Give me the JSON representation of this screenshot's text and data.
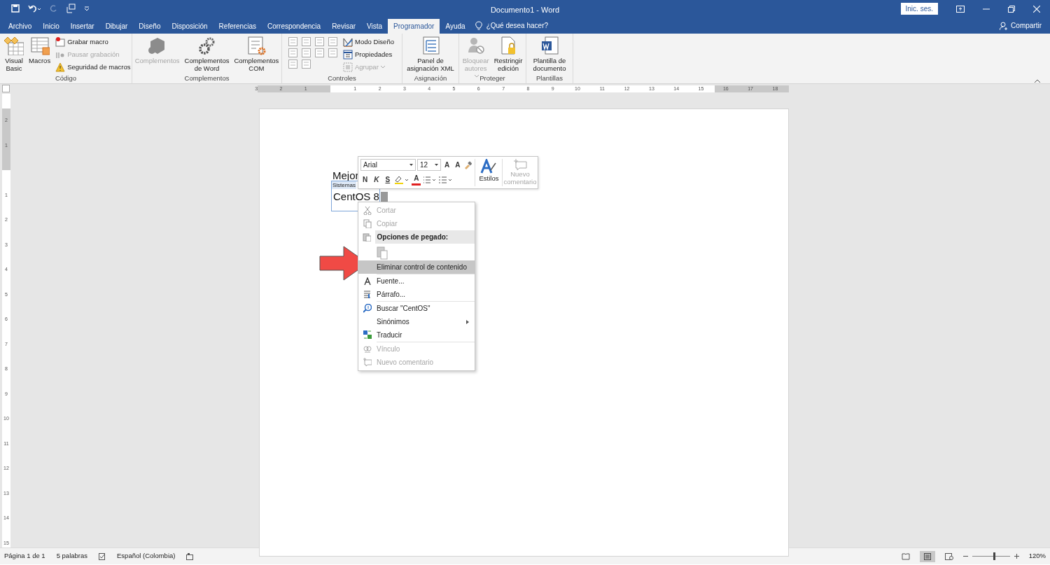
{
  "window": {
    "title": "Documento1  -  Word",
    "sign_in": "Inic. ses."
  },
  "tabs": [
    {
      "label": "Archivo",
      "selected": false
    },
    {
      "label": "Inicio",
      "selected": false
    },
    {
      "label": "Insertar",
      "selected": false
    },
    {
      "label": "Dibujar",
      "selected": false
    },
    {
      "label": "Diseño",
      "selected": false
    },
    {
      "label": "Disposición",
      "selected": false
    },
    {
      "label": "Referencias",
      "selected": false
    },
    {
      "label": "Correspondencia",
      "selected": false
    },
    {
      "label": "Revisar",
      "selected": false
    },
    {
      "label": "Vista",
      "selected": false
    },
    {
      "label": "Programador",
      "selected": true
    },
    {
      "label": "Ayuda",
      "selected": false
    }
  ],
  "tell_me": "¿Qué desea hacer?",
  "share": "Compartir",
  "ribbon": [
    {
      "name": "Código",
      "items": [
        {
          "kind": "large",
          "label": "Visual Basic",
          "disabled": false
        },
        {
          "kind": "large",
          "label": "Macros",
          "disabled": false
        },
        {
          "kind": "stack",
          "entries": [
            {
              "label": "Grabar macro",
              "disabled": false
            },
            {
              "label": "Pausar grabación",
              "disabled": true
            },
            {
              "label": "Seguridad de macros",
              "disabled": false
            }
          ]
        }
      ]
    },
    {
      "name": "Complementos",
      "items": [
        {
          "kind": "large",
          "label": "Complementos",
          "disabled": true
        },
        {
          "kind": "large",
          "label": "Complementos de Word",
          "disabled": false
        },
        {
          "kind": "large",
          "label": "Complementos COM",
          "disabled": false
        }
      ]
    },
    {
      "name": "Controles",
      "items": [
        {
          "kind": "grid"
        },
        {
          "kind": "stack",
          "entries": [
            {
              "label": "Modo Diseño",
              "disabled": false
            },
            {
              "label": "Propiedades",
              "disabled": false
            },
            {
              "label": "Agrupar",
              "disabled": true,
              "dropdown": true
            }
          ]
        }
      ]
    },
    {
      "name": "Asignación",
      "items": [
        {
          "kind": "large",
          "label": "Panel de asignación XML",
          "disabled": false
        }
      ]
    },
    {
      "name": "Proteger",
      "items": [
        {
          "kind": "large",
          "label": "Bloquear autores",
          "disabled": true,
          "dropdown": true
        },
        {
          "kind": "large",
          "label": "Restringir edición",
          "disabled": false
        }
      ]
    },
    {
      "name": "Plantillas",
      "items": [
        {
          "kind": "large",
          "label": "Plantilla de documento",
          "disabled": false
        }
      ]
    }
  ],
  "ruler": {
    "horizontal": [
      "3",
      "2",
      "1",
      "1",
      "2",
      "3",
      "4",
      "5",
      "6",
      "7",
      "8",
      "9",
      "10",
      "11",
      "12",
      "13",
      "14",
      "15",
      "16",
      "17",
      "18"
    ],
    "vertical": [
      "2",
      "1",
      "1",
      "2",
      "3",
      "4",
      "5",
      "6",
      "7",
      "8",
      "9",
      "10",
      "11",
      "12",
      "13",
      "14",
      "15"
    ]
  },
  "document": {
    "heading": "Mejor",
    "control_title": "Sistemas",
    "control_text": "CentOS 8"
  },
  "mini_toolbar": {
    "font": "Arial",
    "size": "12",
    "grow": "A",
    "shrink": "A",
    "format": [
      "N",
      "K",
      "S"
    ],
    "font_color": "A",
    "styles": "Estilos",
    "comment": {
      "label": "Nuevo comentario",
      "disabled": true
    }
  },
  "context_menu": [
    {
      "kind": "item",
      "label": "Cortar",
      "disabled": true,
      "selected": false
    },
    {
      "kind": "item",
      "label": "Copiar",
      "disabled": true,
      "selected": false
    },
    {
      "kind": "header",
      "label": "Opciones de pegado:"
    },
    {
      "kind": "paste_options"
    },
    {
      "kind": "item",
      "label": "Eliminar control de contenido",
      "disabled": false,
      "selected": true
    },
    {
      "kind": "item",
      "label": "Fuente...",
      "disabled": false,
      "selected": false,
      "separator": true
    },
    {
      "kind": "item",
      "label": "Párrafo...",
      "disabled": false,
      "selected": false
    },
    {
      "kind": "item",
      "label": "Buscar \"CentOS\"",
      "disabled": false,
      "selected": false,
      "separator": true
    },
    {
      "kind": "item",
      "label": "Sinónimos",
      "disabled": false,
      "selected": false,
      "submenu": true
    },
    {
      "kind": "item",
      "label": "Traducir",
      "disabled": false,
      "selected": false
    },
    {
      "kind": "item",
      "label": "Vínculo",
      "disabled": true,
      "selected": false,
      "separator": true
    },
    {
      "kind": "item",
      "label": "Nuevo comentario",
      "disabled": true,
      "selected": false
    }
  ],
  "status_bar": {
    "page": "Página 1 de 1",
    "words": "5 palabras",
    "language": "Español (Colombia)",
    "zoom": "120%",
    "zoom_slider": {
      "level": 0.6
    }
  }
}
